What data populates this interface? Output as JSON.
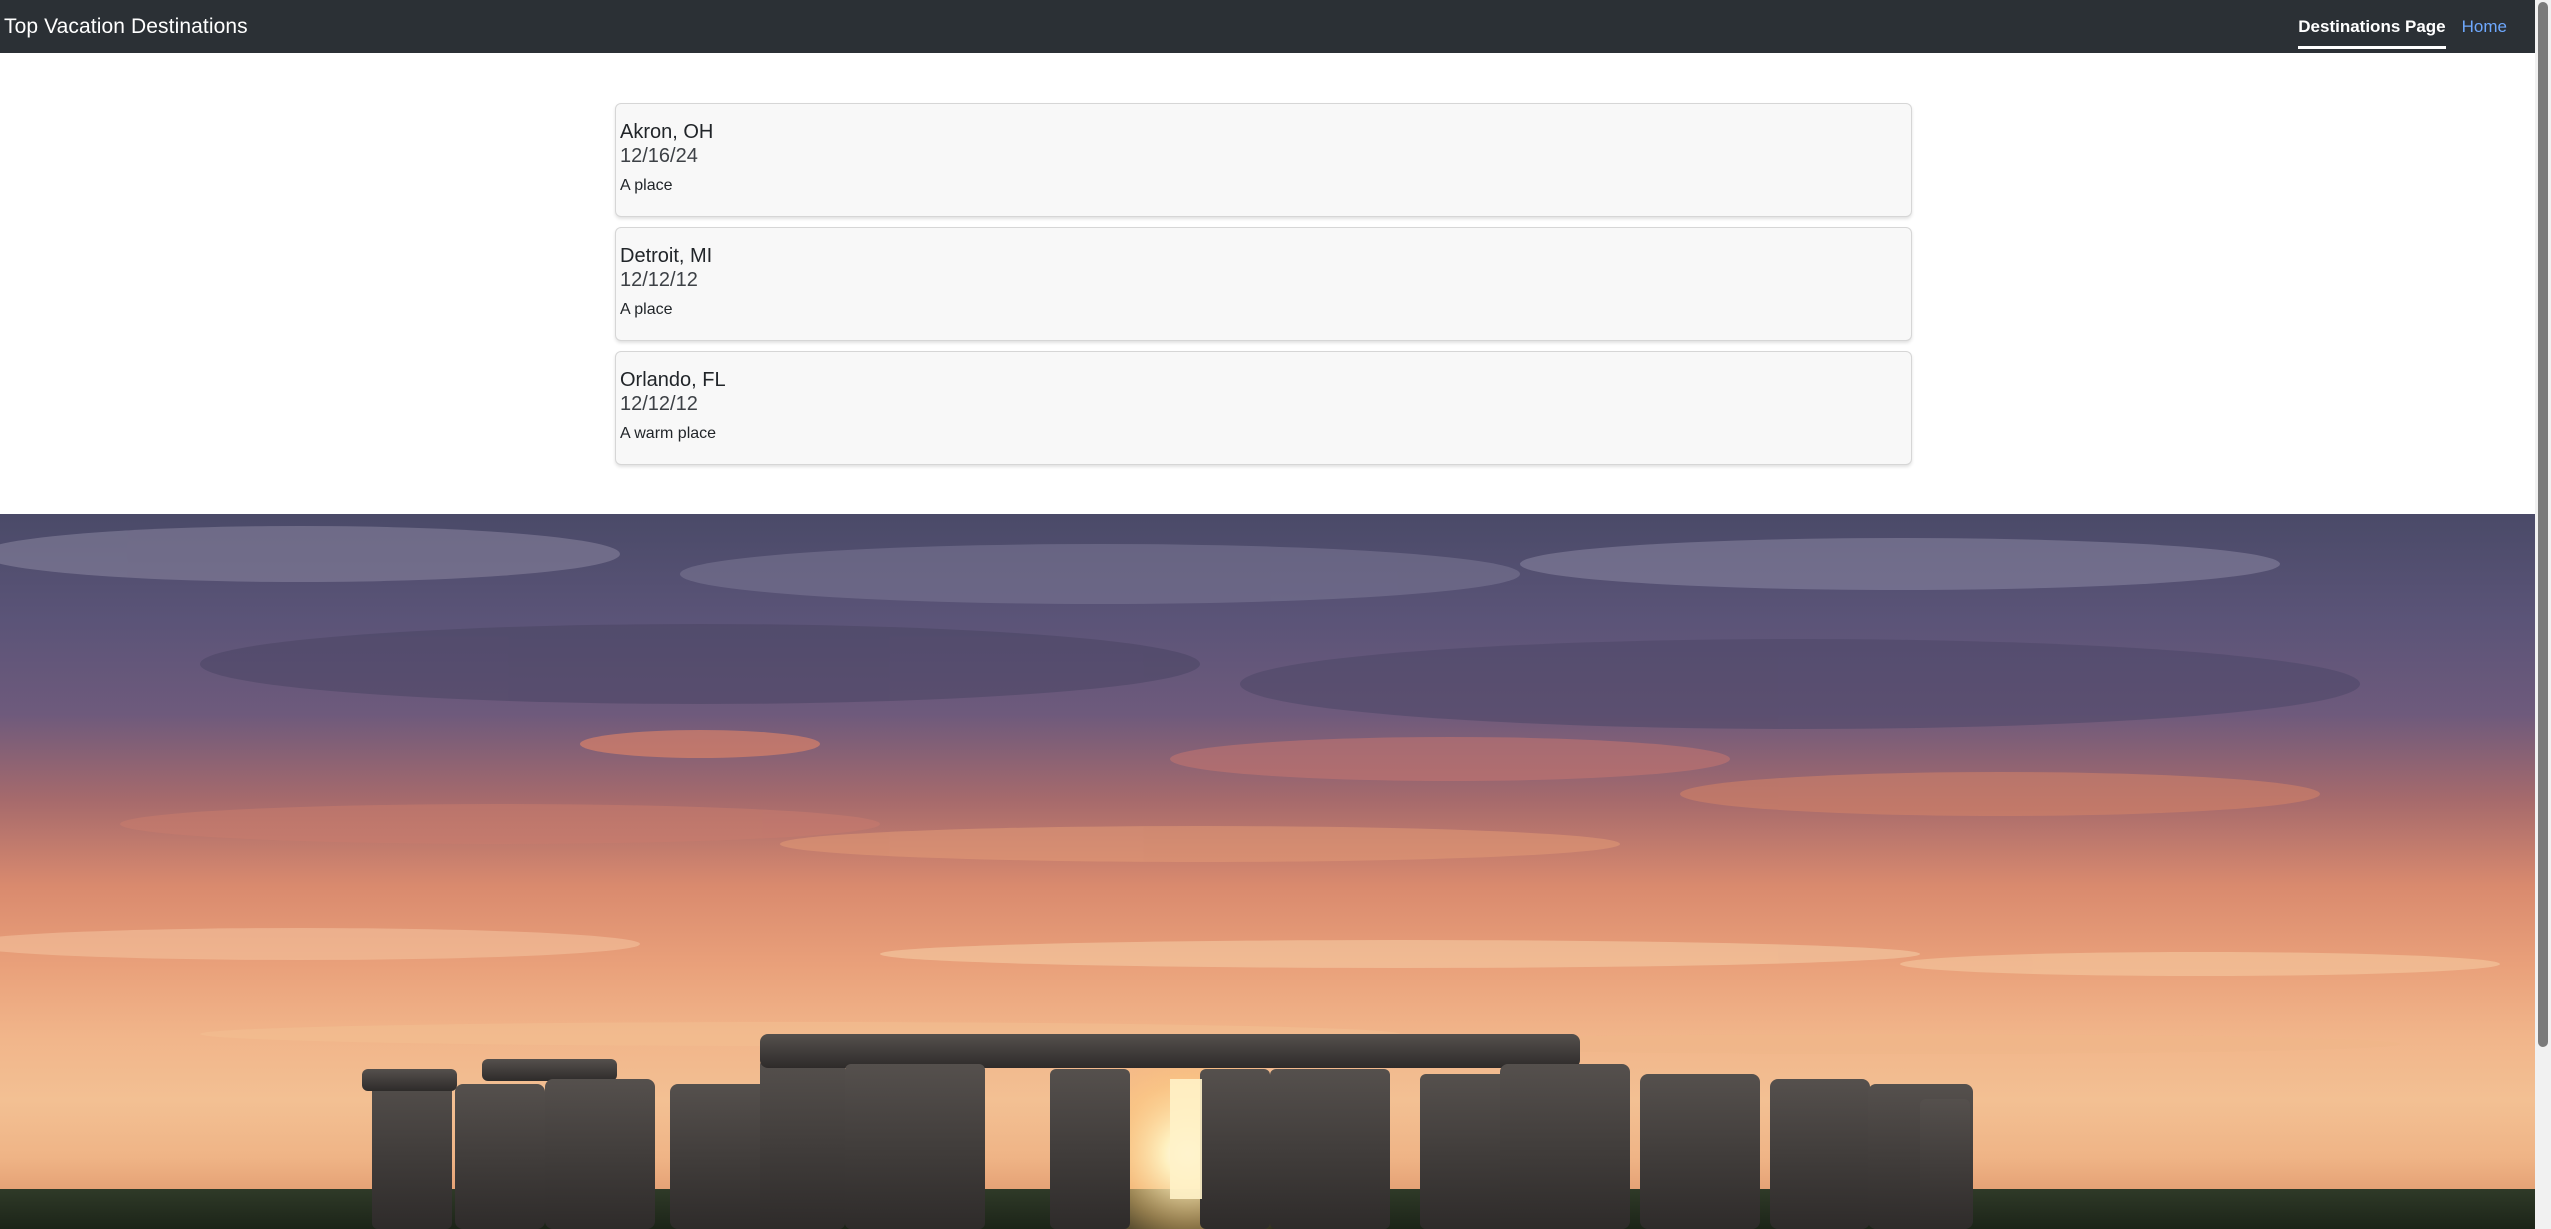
{
  "navbar": {
    "brand": "Top Vacation Destinations",
    "links": [
      {
        "label": "Destinations Page",
        "active": true
      },
      {
        "label": "Home",
        "active": false
      }
    ]
  },
  "destinations": [
    {
      "name": "Akron, OH",
      "date": "12/16/24",
      "description": "A place"
    },
    {
      "name": "Detroit, MI",
      "date": "12/12/12",
      "description": "A place"
    },
    {
      "name": "Orlando, FL",
      "date": "12/12/12",
      "description": "A warm place"
    }
  ],
  "hero": {
    "icon": "stonehenge-sunset-image"
  },
  "colors": {
    "navbar_bg": "#2b3035",
    "active_link": "#ffffff",
    "inactive_link": "#6ea8fe",
    "card_bg": "#f8f8f8"
  }
}
